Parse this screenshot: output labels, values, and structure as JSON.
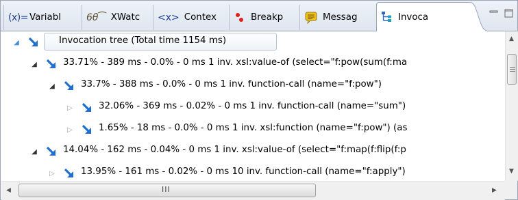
{
  "tabs": [
    {
      "label": "Variabl",
      "icon": "variables-icon"
    },
    {
      "label": "XWatc",
      "icon": "xwatch-icon"
    },
    {
      "label": "Contex",
      "icon": "context-icon"
    },
    {
      "label": "Breakp",
      "icon": "breakpoints-icon"
    },
    {
      "label": "Messag",
      "icon": "messages-icon"
    },
    {
      "label": "Invoca",
      "icon": "invocation-icon",
      "active": true
    }
  ],
  "tab_icon_glyphs": {
    "variables": "(x)=",
    "xwatch": "6θ⁀",
    "context": "<x>"
  },
  "view_controls": {
    "minimize": "minimize-icon",
    "maximize": "maximize-icon"
  },
  "tree": {
    "root": "Invocation tree (Total time  1154 ms)",
    "rows": [
      {
        "state": "expanded",
        "text": "33.71% - 389 ms - 0.0% - 0 ms 1 inv. xsl:value-of (select=\"f:pow(sum(f:ma"
      },
      {
        "state": "expanded",
        "text": "33.7% - 388 ms - 0.0% - 0 ms 1 inv. function-call (name=\"f:pow\")"
      },
      {
        "state": "collapsed",
        "text": "32.06% - 369 ms - 0.02% - 0 ms 1 inv. function-call (name=\"sum\")"
      },
      {
        "state": "collapsed",
        "text": "1.65% - 18 ms - 0.0% - 0 ms 1 inv. xsl:function (name=\"f:pow\") (as"
      },
      {
        "state": "expanded",
        "text": "14.04% - 162 ms - 0.04% - 0 ms 1 inv. xsl:value-of (select=\"f:map(f:flip(f:p"
      },
      {
        "state": "collapsed",
        "text": "13.95% - 161 ms - 0.02% - 0 ms 10 inv. function-call (name=\"f:apply\")"
      }
    ]
  },
  "scrollbar": {
    "h_thumb_grip": "III"
  },
  "colors": {
    "node_icon": "#1f6fd1",
    "breakpoint_red": "#e0201a",
    "message_yellow": "#f2c21a",
    "tab_border": "#9aa6b8"
  }
}
